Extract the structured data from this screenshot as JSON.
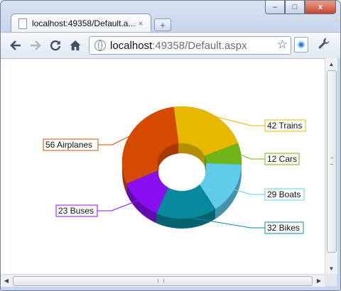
{
  "browser": {
    "tab_title": "localhost:49358/Default.a...",
    "tab_close": "×",
    "new_tab": "+",
    "url_host": "localhost",
    "url_rest": ":49358/Default.aspx",
    "window_buttons": {
      "minimize": "–",
      "maximize": "□",
      "close": "x"
    },
    "icons": {
      "back": "back-arrow-icon",
      "forward": "forward-arrow-icon",
      "reload": "reload-icon",
      "home": "home-icon",
      "star": "bookmark-star-icon",
      "wrench": "wrench-icon"
    }
  },
  "chart_data": {
    "type": "pie",
    "style": "3d-doughnut",
    "categories": [
      "Trains",
      "Cars",
      "Boats",
      "Bikes",
      "Buses",
      "Airplanes"
    ],
    "values": [
      42,
      12,
      29,
      32,
      23,
      56
    ],
    "colors": [
      "#e6b800",
      "#6fb515",
      "#61cbea",
      "#078a9c",
      "#8a0ff0",
      "#d64a00"
    ],
    "labels": [
      "42 Trains",
      "12 Cars",
      "29 Boats",
      "32 Bikes",
      "23 Buses",
      "56 Airplanes"
    ],
    "legend": "none",
    "data_labels": "outside with leader lines"
  }
}
